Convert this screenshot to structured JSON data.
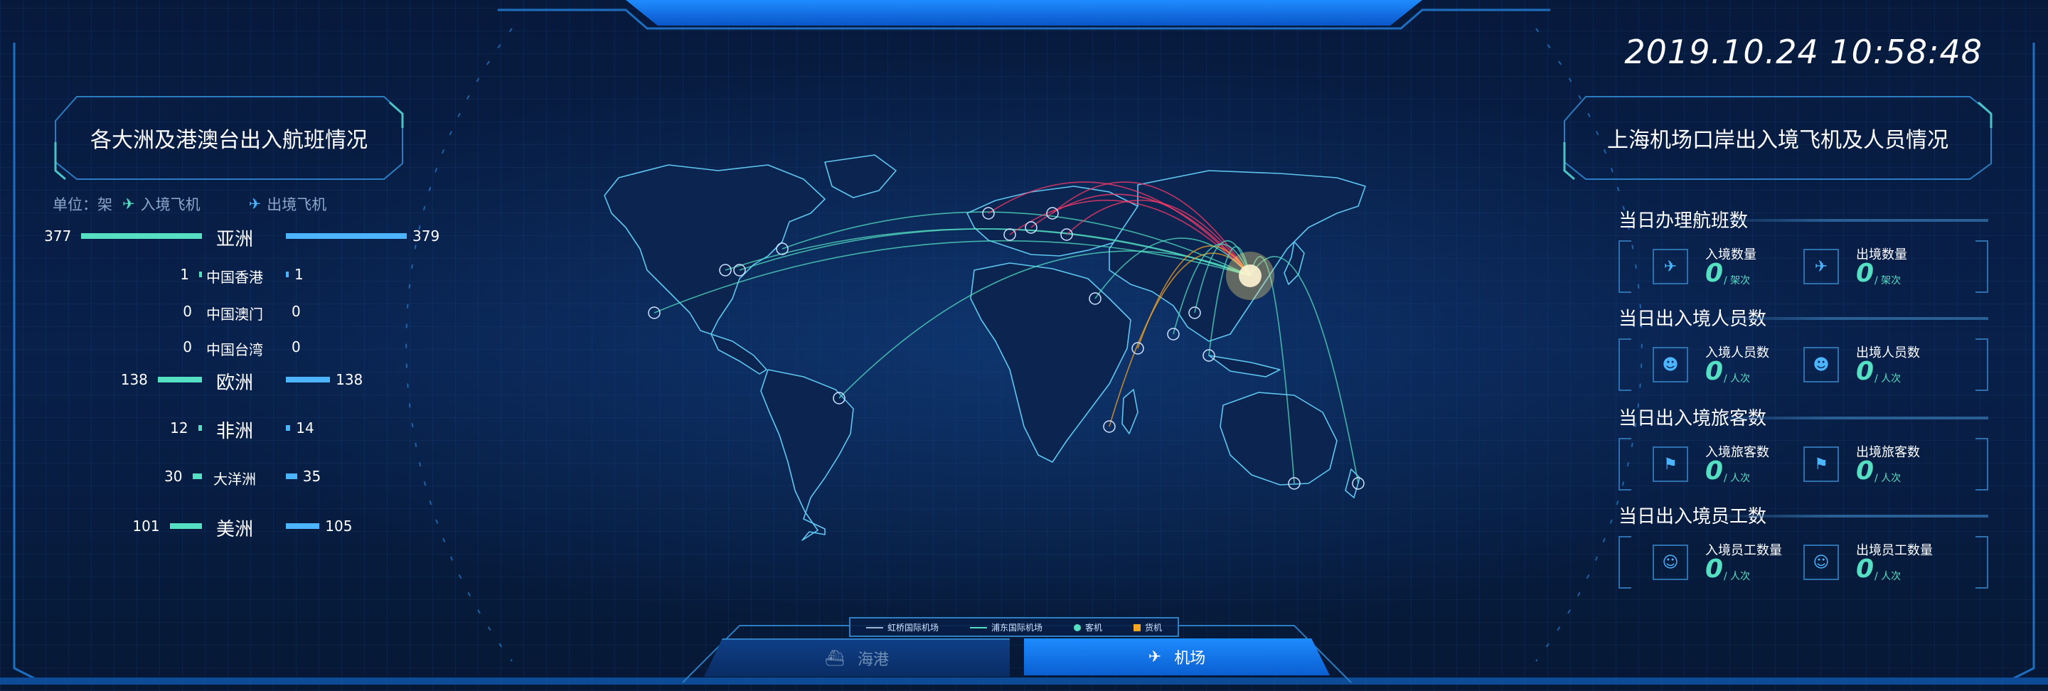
{
  "clock": "2019.10.24 10:58:48",
  "left_panel": {
    "title": "各大洲及港澳台出入航班情况",
    "unit_label": "单位：架",
    "legend_in": "入境飞机",
    "legend_out": "出境飞机",
    "rows": [
      {
        "name": "亚洲",
        "in": 377,
        "out": 379
      },
      {
        "name": "中国香港",
        "in": 1,
        "out": 1
      },
      {
        "name": "中国澳门",
        "in": 0,
        "out": 0
      },
      {
        "name": "中国台湾",
        "in": 0,
        "out": 0
      },
      {
        "name": "欧洲",
        "in": 138,
        "out": 138
      },
      {
        "name": "非洲",
        "in": 12,
        "out": 14
      },
      {
        "name": "大洋洲",
        "in": 30,
        "out": 35
      },
      {
        "name": "美洲",
        "in": 101,
        "out": 105
      }
    ]
  },
  "right_panel": {
    "title": "上海机场口岸出入境飞机及人员情况",
    "sections": [
      {
        "title": "当日办理航班数",
        "left": {
          "label": "入境数量",
          "value": "0",
          "unit": "/ 架次",
          "icon": "plane-landing-icon"
        },
        "right": {
          "label": "出境数量",
          "value": "0",
          "unit": "/ 架次",
          "icon": "plane-takeoff-icon"
        }
      },
      {
        "title": "当日出入境人员数",
        "left": {
          "label": "入境人员数",
          "value": "0",
          "unit": "/ 人次",
          "icon": "person-icon"
        },
        "right": {
          "label": "出境人员数",
          "value": "0",
          "unit": "/ 人次",
          "icon": "person-icon"
        }
      },
      {
        "title": "当日出入境旅客数",
        "left": {
          "label": "入境旅客数",
          "value": "0",
          "unit": "/ 人次",
          "icon": "traveler-icon"
        },
        "right": {
          "label": "出境旅客数",
          "value": "0",
          "unit": "/ 人次",
          "icon": "traveler-icon"
        }
      },
      {
        "title": "当日出入境员工数",
        "left": {
          "label": "入境员工数量",
          "value": "0",
          "unit": "/ 人次",
          "icon": "staff-icon"
        },
        "right": {
          "label": "出境员工数量",
          "value": "0",
          "unit": "/ 人次",
          "icon": "staff-icon"
        }
      }
    ]
  },
  "map_legend": {
    "hongqiao": "虹桥国际机场",
    "pudong": "浦东国际机场",
    "passenger": "客机",
    "cargo": "货机"
  },
  "tabs": {
    "seaport": "海港",
    "airport": "机场"
  },
  "colors": {
    "in": "#56e0c3",
    "out": "#4db4ff",
    "accent": "#1f8cff",
    "europe_flights": "#ff3a6a",
    "cargo": "#f5a623"
  }
}
